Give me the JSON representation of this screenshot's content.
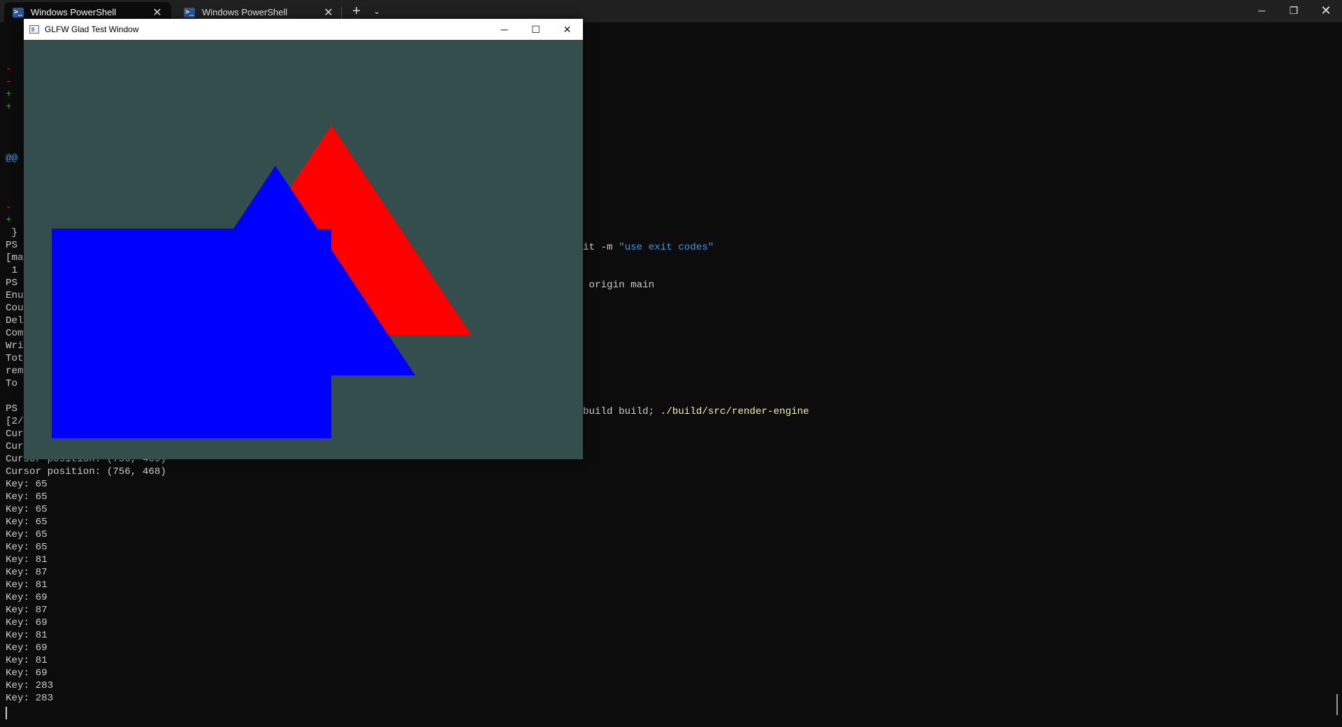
{
  "terminal_app": {
    "tabs": [
      {
        "label": "Windows PowerShell",
        "icon": "powershell-icon",
        "active": true
      },
      {
        "label": "Windows PowerShell",
        "icon": "powershell-icon",
        "active": false
      }
    ],
    "new_tab_glyph": "+",
    "dropdown_glyph": "⌄",
    "window_controls": {
      "minimize": "─",
      "maximize": "❐",
      "close": "✕"
    }
  },
  "terminal_lines": [
    {
      "text": "-",
      "color": "red"
    },
    {
      "text": "-",
      "color": "red"
    },
    {
      "text": "+",
      "color": "green"
    },
    {
      "text": "+",
      "color": "green"
    },
    {
      "text": "@@",
      "color": "cyan"
    },
    {
      "text": "-",
      "color": "red"
    },
    {
      "text": "+",
      "color": "green"
    },
    {
      "text": " }",
      "color": "default"
    },
    {
      "text": "PS",
      "color": "default"
    },
    {
      "text": "[ma",
      "color": "default"
    },
    {
      "text": " 1",
      "color": "default"
    },
    {
      "text": "PS",
      "color": "default"
    },
    {
      "text": "Enu",
      "color": "default"
    },
    {
      "text": "Cou",
      "color": "default"
    },
    {
      "text": "Del",
      "color": "default"
    },
    {
      "text": "Com",
      "color": "default"
    },
    {
      "text": "Wri",
      "color": "default"
    },
    {
      "text": "Tot",
      "color": "default"
    },
    {
      "text": "rem",
      "color": "default"
    },
    {
      "text": "To",
      "color": "default"
    },
    {
      "text": "PS",
      "color": "default"
    },
    {
      "text": "[2/",
      "color": "default"
    },
    {
      "text": "Cur",
      "color": "default"
    },
    {
      "text": "Cur",
      "color": "default"
    },
    {
      "text": "Cursor position: (756, 469)",
      "color": "default"
    },
    {
      "text": "Cursor position: (756, 468)",
      "color": "default"
    },
    {
      "text": "Key: 65",
      "color": "default"
    },
    {
      "text": "Key: 65",
      "color": "default"
    },
    {
      "text": "Key: 65",
      "color": "default"
    },
    {
      "text": "Key: 65",
      "color": "default"
    },
    {
      "text": "Key: 65",
      "color": "default"
    },
    {
      "text": "Key: 65",
      "color": "default"
    },
    {
      "text": "Key: 81",
      "color": "default"
    },
    {
      "text": "Key: 87",
      "color": "default"
    },
    {
      "text": "Key: 81",
      "color": "default"
    },
    {
      "text": "Key: 69",
      "color": "default"
    },
    {
      "text": "Key: 87",
      "color": "default"
    },
    {
      "text": "Key: 69",
      "color": "default"
    },
    {
      "text": "Key: 81",
      "color": "default"
    },
    {
      "text": "Key: 69",
      "color": "default"
    },
    {
      "text": "Key: 81",
      "color": "default"
    },
    {
      "text": "Key: 69",
      "color": "default"
    },
    {
      "text": "Key: 283",
      "color": "default"
    },
    {
      "text": "Key: 283",
      "color": "default"
    }
  ],
  "right_fragments": {
    "commit_cmd": "it -m ",
    "commit_msg": "\"use exit codes\"",
    "push_cmd": " origin main",
    "build_cmd": "build build; ",
    "run_cmd": "./build/src/render-engine"
  },
  "glfw_window": {
    "title": "GLFW Glad Test Window",
    "controls": {
      "minimize": "─",
      "maximize": "☐",
      "close": "✕"
    },
    "background_color": "#344d4d",
    "shapes": [
      {
        "name": "red-triangle",
        "color": "#ff0000"
      },
      {
        "name": "blue-rectangle",
        "color": "#0000ff"
      },
      {
        "name": "blue-triangle",
        "color": "#0000ff"
      }
    ]
  }
}
